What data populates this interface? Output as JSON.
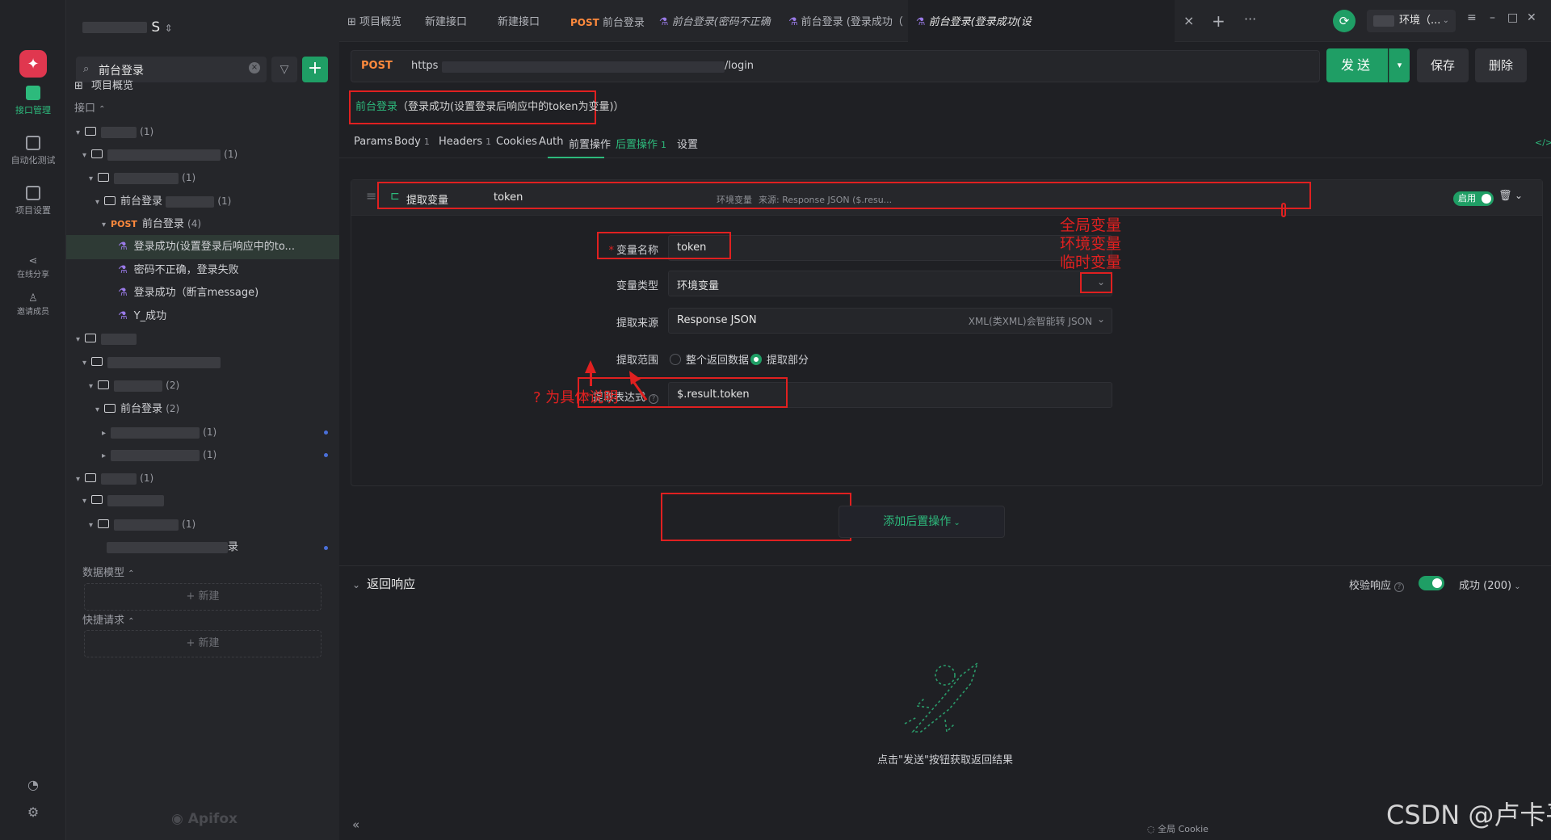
{
  "rail": {
    "items": [
      {
        "label": "接口管理"
      },
      {
        "label": "自动化测试"
      },
      {
        "label": "项目设置"
      },
      {
        "label": "在线分享"
      },
      {
        "label": "邀请成员"
      }
    ]
  },
  "sidebar": {
    "project_title": "S",
    "search_value": "前台登录",
    "overview": "项目概览",
    "api_section": "接口",
    "tree": {
      "row1_count": "(1)",
      "row2_count": "(1)",
      "row3_count": "(1)",
      "row4_label": "前台登录",
      "row4_count": "(1)",
      "row5_method": "POST",
      "row5_label": "前台登录",
      "row5_count": "(4)",
      "case1": "登录成功(设置登录后响应中的to...",
      "case2": "密码不正确，登录失败",
      "case3": "登录成功（断言message)",
      "case4": "Y_成功",
      "row10_count": "(2)",
      "row11_label": "前台登录",
      "row11_count": "(2)",
      "row12_count": "(1)",
      "row13_count": "(1)",
      "row14_count": "(1)",
      "row16_count": "(1)",
      "row17_tail": "录"
    },
    "data_model": "数据模型",
    "quick_request": "快捷请求",
    "new_label": "新建",
    "brand": "Apifox"
  },
  "tabs": [
    {
      "label": "项目概览"
    },
    {
      "label": "新建接口"
    },
    {
      "label": "新建接口"
    },
    {
      "method": "POST",
      "label": "前台登录"
    },
    {
      "label": "前台登录(密码不正确"
    },
    {
      "label": "前台登录 (登录成功（"
    },
    {
      "label": "前台登录(登录成功(设"
    }
  ],
  "env": {
    "label": "环境（..."
  },
  "request": {
    "method": "POST",
    "url_prefix": "https",
    "url_suffix": "/login",
    "send": "发送",
    "save": "保存",
    "delete": "删除"
  },
  "breadcrumb": {
    "api": "前台登录",
    "case": "（登录成功(设置登录后响应中的token为变量)）"
  },
  "subtabs": [
    {
      "label": "Params"
    },
    {
      "label": "Body",
      "count": "1"
    },
    {
      "label": "Headers",
      "count": "1"
    },
    {
      "label": "Cookies"
    },
    {
      "label": "Auth"
    },
    {
      "label": "前置操作"
    },
    {
      "label": "后置操作",
      "count": "1"
    },
    {
      "label": "设置"
    }
  ],
  "post_op": {
    "title": "提取变量",
    "var": "token",
    "scope_meta": "环境变量",
    "source_meta": "来源: Response JSON ($.resu...",
    "enabled_label": "启用",
    "form": {
      "var_name_label": "变量名称",
      "var_name_value": "token",
      "var_type_label": "变量类型",
      "var_type_value": "环境变量",
      "source_label": "提取来源",
      "source_value": "Response JSON",
      "source_hint": "XML(类XML)会智能转 JSON",
      "range_label": "提取范围",
      "range_opt1": "整个返回数据",
      "range_opt2": "提取部分",
      "expr_label": "提取表达式",
      "expr_value": "$.result.token"
    },
    "add_label": "添加后置操作"
  },
  "annotations": {
    "var_types": [
      "全局变量",
      "环境变量",
      "临时变量"
    ],
    "question_note": "? 为具体说明"
  },
  "response": {
    "title": "返回响应",
    "verify_label": "校验响应",
    "status": "成功 (200)",
    "empty_text": "点击\"发送\"按钮获取返回结果"
  },
  "footer": {
    "cookie": "全局 Cookie",
    "watermark": "CSDN @卢卡平头哥"
  },
  "colors": {
    "accent": "#2dba7c",
    "method_post": "#ff8a3d",
    "annotation": "#e02020"
  }
}
